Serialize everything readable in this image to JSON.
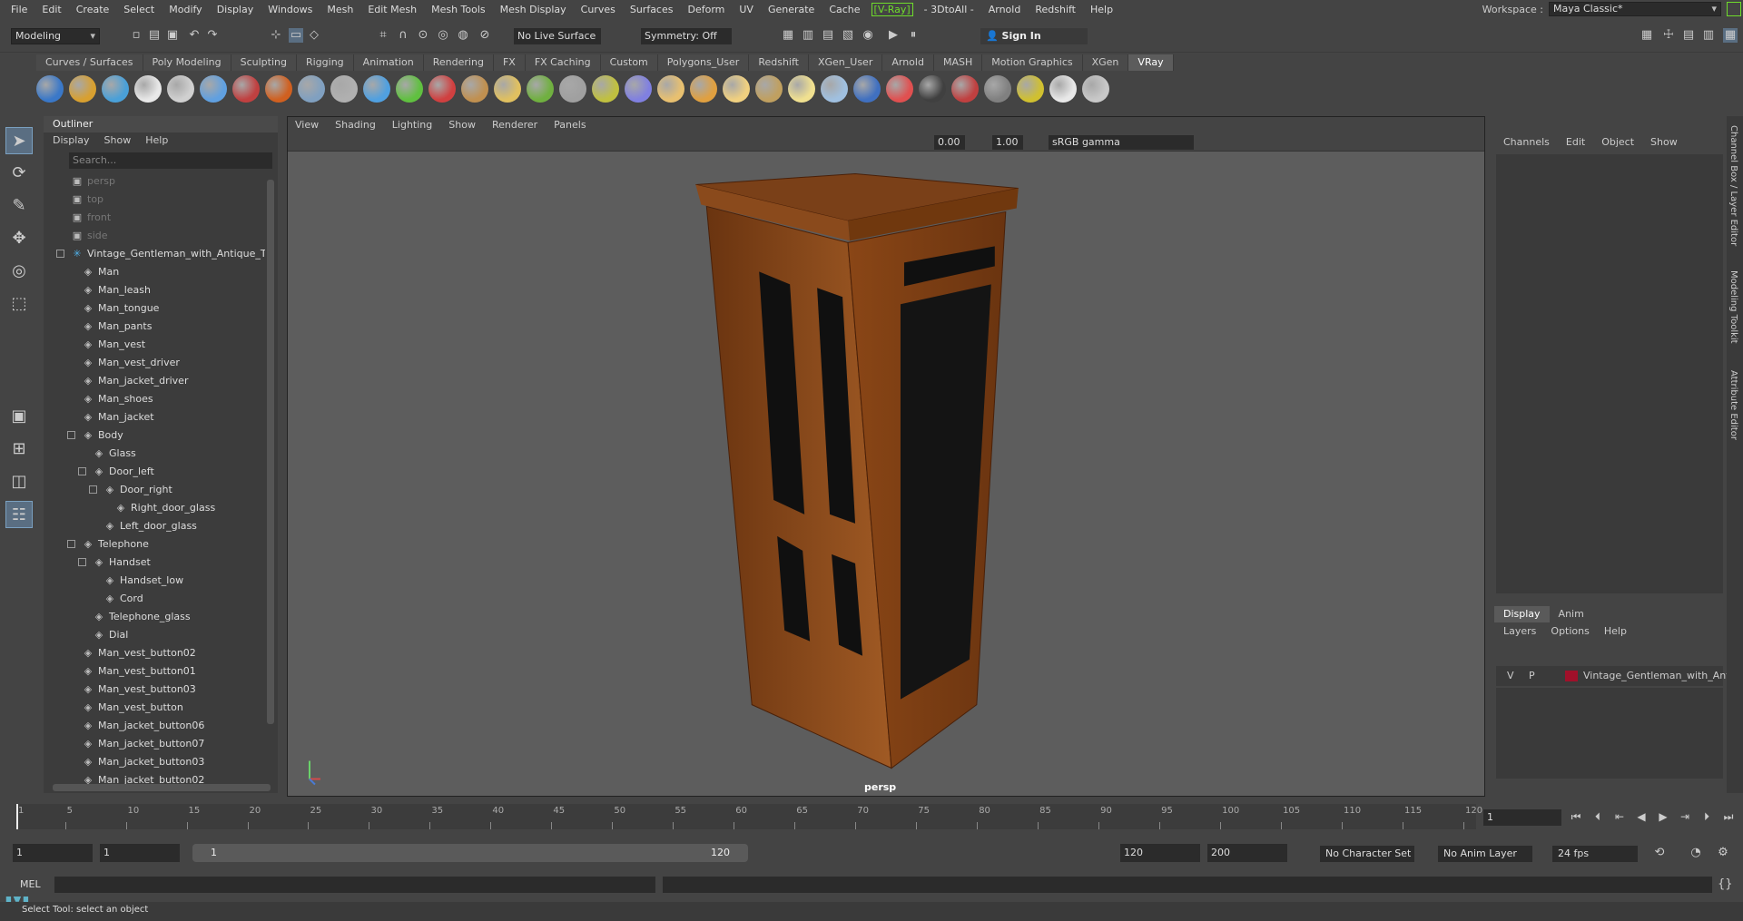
{
  "menubar": {
    "items": [
      "File",
      "Edit",
      "Create",
      "Select",
      "Modify",
      "Display",
      "Windows",
      "Mesh",
      "Edit Mesh",
      "Mesh Tools",
      "Mesh Display",
      "Curves",
      "Surfaces",
      "Deform",
      "UV",
      "Generate",
      "Cache",
      "[V-Ray]",
      "- 3DtoAll -",
      "Arnold",
      "Redshift",
      "Help"
    ],
    "workspace_label": "Workspace :",
    "workspace_value": "Maya Classic*"
  },
  "statusline": {
    "mode": "Modeling",
    "live_surface": "No Live Surface",
    "symmetry": "Symmetry: Off",
    "sign_in": "Sign In"
  },
  "shelf": {
    "tabs": [
      "Curves / Surfaces",
      "Poly Modeling",
      "Sculpting",
      "Rigging",
      "Animation",
      "Rendering",
      "FX",
      "FX Caching",
      "Custom",
      "Polygons_User",
      "Redshift",
      "XGen_User",
      "Arnold",
      "MASH",
      "Motion Graphics",
      "XGen",
      "VRay"
    ],
    "active_tab": "VRay",
    "icon_colors": [
      "#3a78c8",
      "#d8a030",
      "#4aa0d8",
      "#e8e8e8",
      "#d0d0d0",
      "#60a0e0",
      "#c04040",
      "#d06020",
      "#80a0c0",
      "#b0b0b0",
      "#50a0e0",
      "#60c040",
      "#d04040",
      "#c09050",
      "#e0c060",
      "#70b040",
      "#a0a0a0",
      "#c0c040",
      "#8080e0",
      "#e8c070",
      "#e0a040",
      "#f0d080",
      "#c0a060",
      "#f0e090",
      "#a0c0e0",
      "#4070c0",
      "#e05050",
      "#404040",
      "#c04040",
      "#808080",
      "#d0c030",
      "#e8e8e8",
      "#c8c8c8"
    ]
  },
  "outliner": {
    "title": "Outliner",
    "menus": [
      "Display",
      "Show",
      "Help"
    ],
    "search_placeholder": "Search...",
    "rows": [
      {
        "label": "persp",
        "type": "camera",
        "depth": 0
      },
      {
        "label": "top",
        "type": "camera",
        "depth": 0
      },
      {
        "label": "front",
        "type": "camera",
        "depth": 0
      },
      {
        "label": "side",
        "type": "camera",
        "depth": 0
      },
      {
        "label": "Vintage_Gentleman_with_Antique_Te",
        "type": "group",
        "depth": 0
      },
      {
        "label": "Man",
        "type": "mesh",
        "depth": 1
      },
      {
        "label": "Man_leash",
        "type": "mesh",
        "depth": 1
      },
      {
        "label": "Man_tongue",
        "type": "mesh",
        "depth": 1
      },
      {
        "label": "Man_pants",
        "type": "mesh",
        "depth": 1
      },
      {
        "label": "Man_vest",
        "type": "mesh",
        "depth": 1
      },
      {
        "label": "Man_vest_driver",
        "type": "mesh",
        "depth": 1
      },
      {
        "label": "Man_jacket_driver",
        "type": "mesh",
        "depth": 1
      },
      {
        "label": "Man_shoes",
        "type": "mesh",
        "depth": 1
      },
      {
        "label": "Man_jacket",
        "type": "mesh",
        "depth": 1
      },
      {
        "label": "Body",
        "type": "mesh",
        "depth": 1
      },
      {
        "label": "Glass",
        "type": "mesh",
        "depth": 2
      },
      {
        "label": "Door_left",
        "type": "mesh",
        "depth": 2
      },
      {
        "label": "Door_right",
        "type": "mesh",
        "depth": 3
      },
      {
        "label": "Right_door_glass",
        "type": "mesh",
        "depth": 4
      },
      {
        "label": "Left_door_glass",
        "type": "mesh",
        "depth": 3
      },
      {
        "label": "Telephone",
        "type": "mesh",
        "depth": 1
      },
      {
        "label": "Handset",
        "type": "mesh",
        "depth": 2
      },
      {
        "label": "Handset_low",
        "type": "mesh",
        "depth": 3
      },
      {
        "label": "Cord",
        "type": "mesh",
        "depth": 3
      },
      {
        "label": "Telephone_glass",
        "type": "mesh",
        "depth": 2
      },
      {
        "label": "Dial",
        "type": "mesh",
        "depth": 2
      },
      {
        "label": "Man_vest_button02",
        "type": "mesh",
        "depth": 1
      },
      {
        "label": "Man_vest_button01",
        "type": "mesh",
        "depth": 1
      },
      {
        "label": "Man_vest_button03",
        "type": "mesh",
        "depth": 1
      },
      {
        "label": "Man_vest_button",
        "type": "mesh",
        "depth": 1
      },
      {
        "label": "Man_jacket_button06",
        "type": "mesh",
        "depth": 1
      },
      {
        "label": "Man_jacket_button07",
        "type": "mesh",
        "depth": 1
      },
      {
        "label": "Man_jacket_button03",
        "type": "mesh",
        "depth": 1
      },
      {
        "label": "Man_jacket_button02",
        "type": "mesh",
        "depth": 1
      }
    ]
  },
  "viewport": {
    "menus": [
      "View",
      "Shading",
      "Lighting",
      "Show",
      "Renderer",
      "Panels"
    ],
    "exposure": "0.00",
    "gamma": "1.00",
    "color_space": "sRGB gamma",
    "camera_label": "persp"
  },
  "channelbox": {
    "menus": [
      "Channels",
      "Edit",
      "Object",
      "Show"
    ]
  },
  "layers": {
    "tabs": [
      "Display",
      "Anim"
    ],
    "active_tab": "Display",
    "menus": [
      "Layers",
      "Options",
      "Help"
    ],
    "layer": {
      "v": "V",
      "p": "P",
      "name": "Vintage_Gentleman_with_Anti",
      "color": "#a0102a"
    }
  },
  "sidetabs": [
    "Channel Box / Layer Editor",
    "Modeling Toolkit",
    "Attribute Editor"
  ],
  "timeslider": {
    "ticks": [
      1,
      5,
      10,
      15,
      20,
      25,
      30,
      35,
      40,
      45,
      50,
      55,
      60,
      65,
      70,
      75,
      80,
      85,
      90,
      95,
      100,
      105,
      110,
      115,
      120
    ],
    "start": 1,
    "end": 120,
    "current_frame": "1"
  },
  "rangeslider": {
    "start_frame": "1",
    "range_start": "1",
    "range_label_start": "1",
    "range_label_end": "120",
    "range_end": "120",
    "anim_end": "200",
    "character_set": "No Character Set",
    "anim_layer": "No Anim Layer",
    "fps": "24 fps"
  },
  "cmdline": {
    "label": "MEL"
  },
  "helpline": {
    "text": "Select Tool: select an object"
  }
}
